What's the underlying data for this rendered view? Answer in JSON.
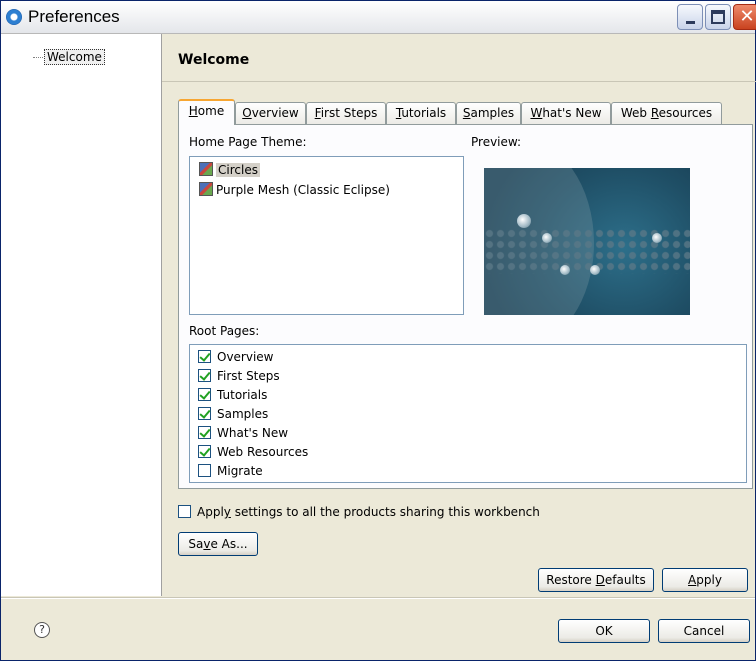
{
  "window": {
    "title": "Preferences",
    "close_glyph": "✕"
  },
  "tree": {
    "items": [
      "Welcome"
    ]
  },
  "page": {
    "title": "Welcome"
  },
  "tabs": [
    {
      "label": "Home",
      "mnemonic": "H",
      "rest": "ome",
      "active": true
    },
    {
      "label": "Overview",
      "mnemonic": "O",
      "rest": "verview"
    },
    {
      "label": "First Steps",
      "mnemonic": "F",
      "rest": "irst Steps"
    },
    {
      "label": "Tutorials",
      "mnemonic": "T",
      "rest": "utorials"
    },
    {
      "label": "Samples",
      "mnemonic": "S",
      "rest": "amples"
    },
    {
      "label": "What's New",
      "mnemonic": "W",
      "rest": "hat's New"
    },
    {
      "label": "Web Resources",
      "pre": "Web ",
      "mnemonic": "R",
      "rest": "esources"
    }
  ],
  "home": {
    "theme_label": "Home Page Theme:",
    "preview_label": "Preview:",
    "themes": [
      {
        "label": "Circles",
        "selected": true
      },
      {
        "label": "Purple Mesh (Classic Eclipse)",
        "selected": false
      }
    ],
    "root_pages_label": "Root Pages:",
    "root_pages": [
      {
        "label": "Overview",
        "checked": true
      },
      {
        "label": "First Steps",
        "checked": true
      },
      {
        "label": "Tutorials",
        "checked": true
      },
      {
        "label": "Samples",
        "checked": true
      },
      {
        "label": "What's New",
        "checked": true
      },
      {
        "label": "Web Resources",
        "checked": true
      },
      {
        "label": "Migrate",
        "checked": false
      }
    ]
  },
  "apply_all": {
    "pre": "Appl",
    "mnemonic": "y",
    "rest": " settings to all the products sharing this workbench",
    "checked": false
  },
  "buttons": {
    "save_as": {
      "pre": "Sa",
      "mnemonic": "v",
      "rest": "e As..."
    },
    "restore_defaults": {
      "pre": "Restore ",
      "mnemonic": "D",
      "rest": "efaults"
    },
    "apply": {
      "pre": "",
      "mnemonic": "A",
      "rest": "pply"
    },
    "ok": "OK",
    "cancel": "Cancel"
  },
  "help_glyph": "?"
}
